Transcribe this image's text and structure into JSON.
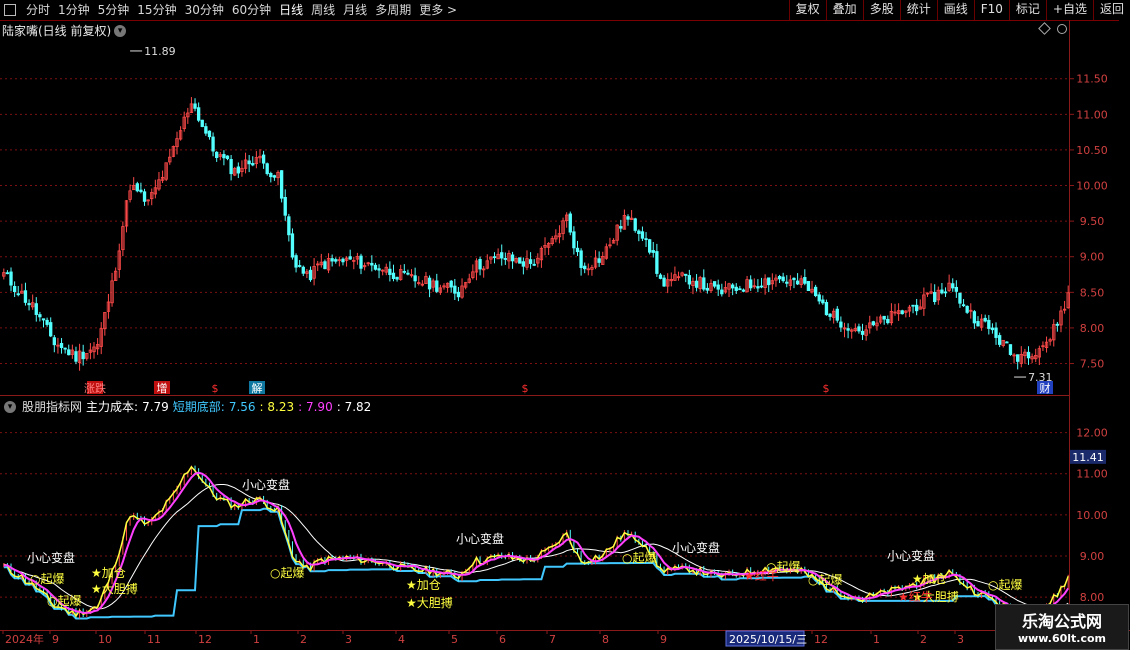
{
  "toolbar": {
    "periods": [
      "分时",
      "1分钟",
      "5分钟",
      "15分钟",
      "30分钟",
      "60分钟",
      "日线",
      "周线",
      "月线",
      "多周期",
      "更多 >"
    ],
    "active": "日线",
    "right": [
      "复权",
      "叠加",
      "多股",
      "统计",
      "画线",
      "F10",
      "标记",
      "+自选",
      "返回"
    ]
  },
  "main": {
    "title": "陆家嘴(日线 前复权)",
    "high_label": "11.89",
    "low_label": "7.31",
    "yticks": [
      "11.50",
      "11.00",
      "10.50",
      "10.00",
      "9.50",
      "9.00",
      "8.50",
      "8.00",
      "7.50"
    ],
    "events": [
      "涨跌",
      "增",
      "$",
      "解",
      "$",
      "$",
      "财"
    ]
  },
  "indicator": {
    "name": "股朋指标网",
    "main_cost_label": "主力成本:",
    "main_cost": "7.79",
    "short_bottom_label": "短期底部:",
    "short_bottom": "7.56",
    "v3": "8.23",
    "v4": "7.90",
    "v5": "7.82",
    "yticks": [
      "12.00",
      "11.00",
      "10.00",
      "9.00",
      "8.00"
    ],
    "current_price": "11.41",
    "signals": {
      "qibao": "○起爆",
      "jiacang": "★加仓",
      "dadanbo": "★大胆搏",
      "xiaoxin": "小心变盘",
      "hongniu": "★红牛"
    }
  },
  "xaxis": {
    "labels": [
      "2024年",
      "9",
      "10",
      "11",
      "12",
      "1",
      "2",
      "3",
      "4",
      "5",
      "6",
      "7",
      "8",
      "9",
      "1",
      "2025/10/15/三",
      "12",
      "1",
      "2",
      "3"
    ]
  },
  "watermark": {
    "title": "乐淘公式网",
    "url": "www.60lt.com"
  },
  "chart_data": {
    "type": "candlestick",
    "title": "陆家嘴(日线 前复权)",
    "ylim": [
      7.1,
      12.1
    ],
    "y_ticks": [
      7.5,
      8.0,
      8.5,
      9.0,
      9.5,
      10.0,
      10.5,
      11.0,
      11.5
    ],
    "annotated_high": 11.89,
    "annotated_low": 7.31,
    "x_labels": [
      "2024年",
      "9",
      "10",
      "11",
      "12",
      "1",
      "2",
      "3",
      "4",
      "5",
      "6",
      "7",
      "8",
      "9",
      "1",
      "2025/10/15/三",
      "12",
      "1",
      "2",
      "3"
    ],
    "close_anchors": [
      [
        0,
        8.75
      ],
      [
        8,
        8.3
      ],
      [
        14,
        7.8
      ],
      [
        20,
        7.6
      ],
      [
        26,
        7.75
      ],
      [
        30,
        8.6
      ],
      [
        35,
        10.0
      ],
      [
        40,
        9.75
      ],
      [
        46,
        10.35
      ],
      [
        52,
        11.2
      ],
      [
        58,
        10.5
      ],
      [
        64,
        10.2
      ],
      [
        70,
        10.4
      ],
      [
        76,
        10.1
      ],
      [
        80,
        9.0
      ],
      [
        84,
        8.7
      ],
      [
        88,
        8.9
      ],
      [
        96,
        8.95
      ],
      [
        104,
        8.85
      ],
      [
        112,
        8.7
      ],
      [
        120,
        8.6
      ],
      [
        126,
        8.5
      ],
      [
        130,
        8.85
      ],
      [
        138,
        9.0
      ],
      [
        146,
        8.9
      ],
      [
        152,
        9.2
      ],
      [
        156,
        9.55
      ],
      [
        160,
        8.85
      ],
      [
        166,
        9.0
      ],
      [
        172,
        9.55
      ],
      [
        178,
        9.3
      ],
      [
        182,
        8.65
      ],
      [
        190,
        8.7
      ],
      [
        198,
        8.5
      ],
      [
        206,
        8.6
      ],
      [
        214,
        8.7
      ],
      [
        222,
        8.6
      ],
      [
        230,
        8.15
      ],
      [
        238,
        7.95
      ],
      [
        246,
        8.15
      ],
      [
        252,
        8.3
      ],
      [
        258,
        8.45
      ],
      [
        262,
        8.6
      ],
      [
        268,
        8.2
      ],
      [
        274,
        7.95
      ],
      [
        280,
        7.6
      ],
      [
        286,
        7.7
      ],
      [
        290,
        7.85
      ],
      [
        295,
        8.45
      ]
    ],
    "series": [
      {
        "name": "主力成本",
        "last": 7.79
      },
      {
        "name": "短期底部",
        "last": 7.56
      }
    ]
  },
  "colors": {
    "up": "#ff4a4a",
    "down": "#54ffff",
    "white": "#ffffff",
    "magenta": "#ff40ff",
    "yellow": "#ffff40",
    "cyan": "#40c8ff",
    "grid": "#7a1010",
    "axis": "#8a1a1a"
  }
}
